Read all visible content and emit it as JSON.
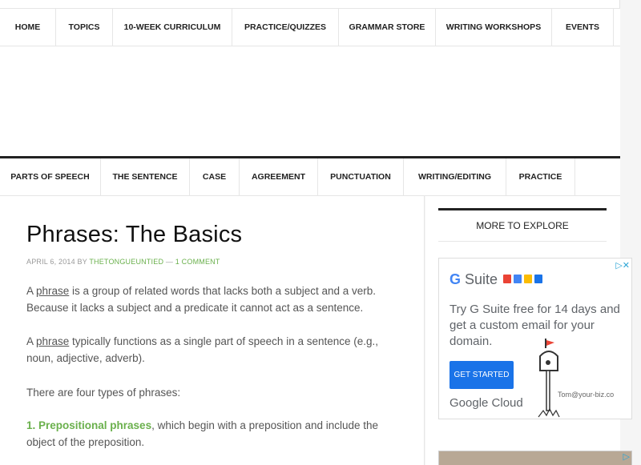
{
  "top_nav": [
    "HOME",
    "TOPICS",
    "10-WEEK CURRICULUM",
    "PRACTICE/QUIZZES",
    "GRAMMAR STORE",
    "WRITING WORKSHOPS",
    "EVENTS"
  ],
  "secondary_nav": [
    "PARTS OF SPEECH",
    "THE SENTENCE",
    "CASE",
    "AGREEMENT",
    "PUNCTUATION",
    "WRITING/EDITING",
    "PRACTICE"
  ],
  "post": {
    "title": "Phrases: The Basics",
    "date": "APRIL 6, 2014",
    "by": "BY",
    "author": "THETONGUEUNTIED",
    "sep": "—",
    "comments": "1 COMMENT",
    "p1": {
      "a": "A ",
      "link": "phrase",
      "rest_line1": " is a group of related words that lacks both a subject and a verb.",
      "line2": "Because it lacks a subject and a predicate it cannot act as a sentence."
    },
    "p2": {
      "a": "A ",
      "link": "phrase",
      "rest_line1": " typically functions as a single part of speech in a sentence (e.g.,",
      "line2": "noun, adjective, adverb)."
    },
    "p3": "There are four types of phrases:",
    "p4": {
      "num": "1.",
      "link": "Prepositional phrases",
      "rest_line1": ", which begin with a preposition and include the",
      "line2": "object of the preposition."
    }
  },
  "sidebar": {
    "widget_title": "MORE TO EXPLORE",
    "ad": {
      "brand_g": "G",
      "brand_rest": " Suite",
      "text": "Try G Suite free for 14 days and get a custom email for your domain.",
      "button": "GET STARTED",
      "google_cloud": "Google Cloud",
      "email": "Tom@your-biz.co",
      "adchoices": "▷✕"
    },
    "ad2_adchoices": "▷"
  },
  "colors": {
    "link_green": "#6ab04c",
    "ad_button_blue": "#1a73e8",
    "nav_border": "#222222"
  }
}
